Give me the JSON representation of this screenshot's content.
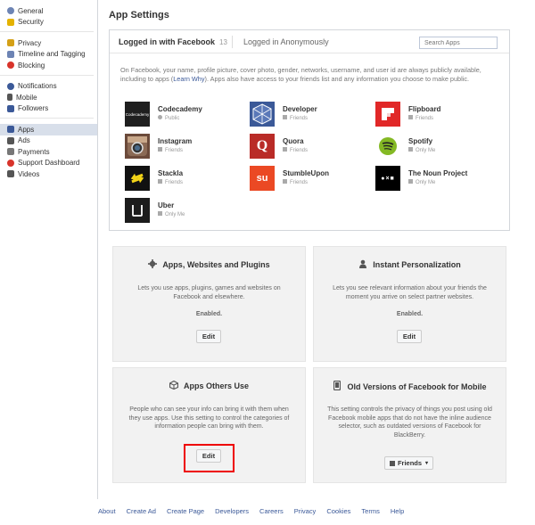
{
  "sidebar": {
    "groups": [
      [
        {
          "label": "General",
          "icon": "gear-icon",
          "color": "#6d84b4"
        },
        {
          "label": "Security",
          "icon": "shield-icon",
          "color": "#e4b200"
        }
      ],
      [
        {
          "label": "Privacy",
          "icon": "lock-icon",
          "color": "#d4a017"
        },
        {
          "label": "Timeline and Tagging",
          "icon": "timeline-icon",
          "color": "#6d84b4"
        },
        {
          "label": "Blocking",
          "icon": "block-icon",
          "color": "#d8342b"
        }
      ],
      [
        {
          "label": "Notifications",
          "icon": "globe-icon",
          "color": "#3b5998"
        },
        {
          "label": "Mobile",
          "icon": "mobile-icon",
          "color": "#555"
        },
        {
          "label": "Followers",
          "icon": "rss-icon",
          "color": "#3b5998"
        }
      ],
      [
        {
          "label": "Apps",
          "icon": "apps-icon",
          "color": "#3b5998",
          "active": true
        },
        {
          "label": "Ads",
          "icon": "ads-icon",
          "color": "#555"
        },
        {
          "label": "Payments",
          "icon": "payments-icon",
          "color": "#777"
        },
        {
          "label": "Support Dashboard",
          "icon": "lifebuoy-icon",
          "color": "#d8342b"
        },
        {
          "label": "Videos",
          "icon": "film-icon",
          "color": "#555"
        }
      ]
    ]
  },
  "page_title": "App Settings",
  "tabs": {
    "active_label": "Logged in with Facebook",
    "active_count": "13",
    "inactive_label": "Logged in Anonymously"
  },
  "search": {
    "placeholder": "Search Apps"
  },
  "description": {
    "before": "On Facebook, your name, profile picture, cover photo, gender, networks, username, and user id are always publicly available, including to apps (",
    "link": "Learn Why",
    "after": "). Apps also have access to your friends list and any information you choose to make public."
  },
  "apps": [
    {
      "name": "Codecademy",
      "privacy": "Public",
      "icon_text": "Codecademy",
      "color": "#1f1f1f"
    },
    {
      "name": "Developer",
      "privacy": "Friends",
      "icon_text": "",
      "color": "#3b5998"
    },
    {
      "name": "Flipboard",
      "privacy": "Friends",
      "icon_text": "",
      "color": "#e12828"
    },
    {
      "name": "Instagram",
      "privacy": "Friends",
      "icon_text": "",
      "color": "#6b4a3a"
    },
    {
      "name": "Quora",
      "privacy": "Friends",
      "icon_text": "Q",
      "color": "#b92b27"
    },
    {
      "name": "Spotify",
      "privacy": "Only Me",
      "icon_text": "",
      "color": "#ffffff"
    },
    {
      "name": "Stackla",
      "privacy": "Friends",
      "icon_text": "",
      "color": "#111111"
    },
    {
      "name": "StumbleUpon",
      "privacy": "Friends",
      "icon_text": "su",
      "color": "#eb4924"
    },
    {
      "name": "The Noun Project",
      "privacy": "Only Me",
      "icon_text": "●×■",
      "color": "#000000"
    },
    {
      "name": "Uber",
      "privacy": "Only Me",
      "icon_text": "",
      "color": "#1c1c1c"
    }
  ],
  "cards": {
    "apps_websites": {
      "title": "Apps, Websites and Plugins",
      "desc": "Lets you use apps, plugins, games and websites on Facebook and elsewhere.",
      "status": "Enabled.",
      "button": "Edit"
    },
    "instant_personalization": {
      "title": "Instant Personalization",
      "desc": "Lets you see relevant information about your friends the moment you arrive on select partner websites.",
      "status": "Enabled.",
      "button": "Edit"
    },
    "apps_others_use": {
      "title": "Apps Others Use",
      "desc": "People who can see your info can bring it with them when they use apps. Use this setting to control the categories of information people can bring with them.",
      "button": "Edit"
    },
    "old_versions": {
      "title": "Old Versions of Facebook for Mobile",
      "desc": "This setting controls the privacy of things you post using old Facebook mobile apps that do not have the inline audience selector, such as outdated versions of Facebook for BlackBerry.",
      "button": "Friends"
    }
  },
  "footer": [
    "About",
    "Create Ad",
    "Create Page",
    "Developers",
    "Careers",
    "Privacy",
    "Cookies",
    "Terms",
    "Help"
  ],
  "colors": {
    "link": "#3b5998",
    "highlight": "#e00000"
  }
}
